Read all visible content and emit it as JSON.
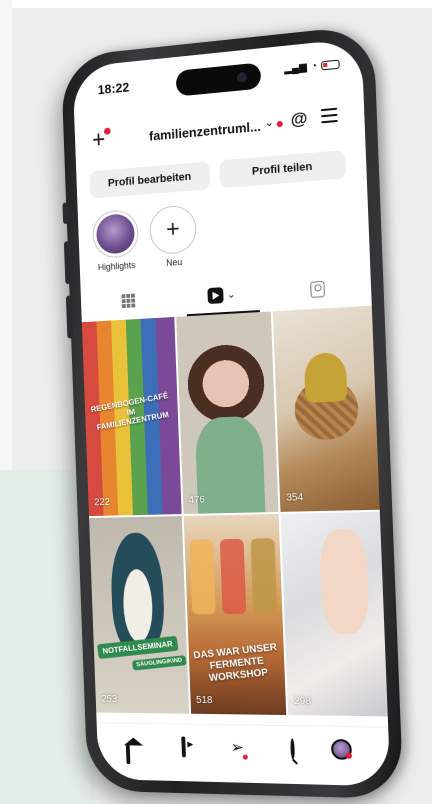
{
  "status_bar": {
    "time": "18:22",
    "signal": "▂▄▆",
    "wifi": "◔"
  },
  "header": {
    "username": "familienzentruml...",
    "chevron": "⌄",
    "threads_glyph": "@"
  },
  "profile_buttons": {
    "edit": "Profil bearbeiten",
    "share": "Profil teilen"
  },
  "highlights": [
    {
      "label": "Highlights"
    },
    {
      "label": "Neu",
      "glyph": "+"
    }
  ],
  "tabs": {
    "reels_chevron": "⌄"
  },
  "posts": [
    {
      "overlay": "REGENBOGEN-CAFÉ IM FAMILIENZENTRUM",
      "views": "222"
    },
    {
      "overlay": "",
      "views": "476"
    },
    {
      "overlay": "",
      "views": "354"
    },
    {
      "overlay": "NOTFALLSEMINAR",
      "overlay2": "SÄUGLING/KIND",
      "views": "253"
    },
    {
      "overlay": "DAS WAR UNSER FERMENTE WORKSHOP",
      "views": "518"
    },
    {
      "overlay": "",
      "views": "298"
    }
  ],
  "bottom_nav": {
    "send_glyph": "➢"
  },
  "colors": {
    "notification_red": "#e3203a",
    "accent_green": "#2f8a4d"
  }
}
